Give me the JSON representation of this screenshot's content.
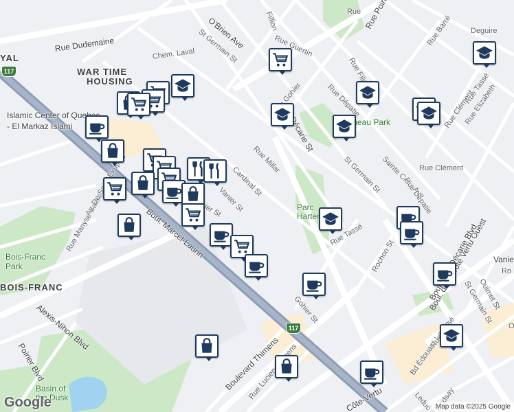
{
  "map": {
    "attribution": "Map data ©2025 Google",
    "logo": "Google",
    "highway_shields": [
      "117",
      "117"
    ],
    "labels": [
      {
        "text": "Rue Dudemaine",
        "style": "dark"
      },
      {
        "text": "WAR TIME",
        "style": "big"
      },
      {
        "text": "HOUSING",
        "style": "big"
      },
      {
        "text": "Chem. Laval",
        "style": ""
      },
      {
        "text": "O'Brien Ave",
        "style": "dark"
      },
      {
        "text": "St Germain St",
        "style": ""
      },
      {
        "text": "Rue Guertin",
        "style": ""
      },
      {
        "text": "Rue Poirier",
        "style": "dark"
      },
      {
        "text": "Rue Barré",
        "style": ""
      },
      {
        "text": "Deguire",
        "style": ""
      },
      {
        "text": "Rue Tassé",
        "style": ""
      },
      {
        "text": "Rue Filion",
        "style": ""
      },
      {
        "text": "Rue Dépatie",
        "style": ""
      },
      {
        "text": "Rue Clément",
        "style": ""
      },
      {
        "text": "Rue Elizabeth",
        "style": ""
      },
      {
        "text": "Chameau Park",
        "style": "park"
      },
      {
        "text": "Décarie St",
        "style": "dark"
      },
      {
        "text": "Rue Millar",
        "style": ""
      },
      {
        "text": "St Germain St",
        "style": ""
      },
      {
        "text": "Sainte Croix Ave",
        "style": ""
      },
      {
        "text": "Rue Dépatie",
        "style": ""
      },
      {
        "text": "Rue Clément",
        "style": ""
      },
      {
        "text": "Parc",
        "style": "park"
      },
      {
        "text": "Hartens",
        "style": "park"
      },
      {
        "text": "Rue Tassé",
        "style": ""
      },
      {
        "text": "Rochon St",
        "style": ""
      },
      {
        "text": "Boul. de la Côte Vertu Ouest",
        "style": "dark"
      },
      {
        "text": "Vanier",
        "style": "dark"
      },
      {
        "text": "St Germain St",
        "style": ""
      },
      {
        "text": "Ouimet St",
        "style": ""
      },
      {
        "text": "Boulevard Décarie Blvd",
        "style": "dark"
      },
      {
        "text": "Bd Édouard-Laurin",
        "style": ""
      },
      {
        "text": "Rue Tassé",
        "style": ""
      },
      {
        "text": "Ouimet",
        "style": ""
      },
      {
        "text": "Ro",
        "style": ""
      },
      {
        "text": "Islamic Center of Quebec",
        "style": "dark"
      },
      {
        "text": "- El Markaz Islami",
        "style": "dark"
      },
      {
        "text": "YAL",
        "style": "big"
      },
      {
        "text": "Cardinal St",
        "style": ""
      },
      {
        "text": "Vanier St",
        "style": ""
      },
      {
        "text": "Gohier St",
        "style": ""
      },
      {
        "text": "Boul. Marcel-Laurin",
        "style": "dark"
      },
      {
        "text": "Rue Manyse-Bastié",
        "style": ""
      },
      {
        "text": "Av. De Saint-Exupéry",
        "style": ""
      },
      {
        "text": "Bois-Franc",
        "style": "park"
      },
      {
        "text": "Park",
        "style": "park"
      },
      {
        "text": "BOIS-FRANC",
        "style": "big"
      },
      {
        "text": "Alexis-Nihon Blvd",
        "style": "dark"
      },
      {
        "text": "Poirier Blvd",
        "style": "dark"
      },
      {
        "text": "Basin of",
        "style": "park"
      },
      {
        "text": "the Dusk",
        "style": "park"
      },
      {
        "text": "Boulevard Thimens",
        "style": "dark"
      },
      {
        "text": "Rue Lucien-Thimens",
        "style": ""
      },
      {
        "text": "Côte-Vertu",
        "style": "dark"
      },
      {
        "text": "Gohier St",
        "style": ""
      },
      {
        "text": "Leduc St",
        "style": ""
      },
      {
        "text": "Lindsay",
        "style": ""
      },
      {
        "text": "Rue Gohier",
        "style": ""
      },
      {
        "text": "Fillion",
        "style": ""
      },
      {
        "text": "Rue",
        "style": ""
      }
    ],
    "markers": [
      {
        "icon": "cart"
      },
      {
        "icon": "school"
      },
      {
        "icon": "school"
      },
      {
        "icon": "school"
      },
      {
        "icon": "school"
      },
      {
        "icon": "school"
      },
      {
        "icon": "school"
      },
      {
        "icon": "cart"
      },
      {
        "icon": "cart"
      },
      {
        "icon": "school"
      },
      {
        "icon": "bag"
      },
      {
        "icon": "cart"
      },
      {
        "icon": "coffee"
      },
      {
        "icon": "bag"
      },
      {
        "icon": "cart"
      },
      {
        "icon": "cart"
      },
      {
        "icon": "cart"
      },
      {
        "icon": "restaurant"
      },
      {
        "icon": "restaurant"
      },
      {
        "icon": "cart"
      },
      {
        "icon": "bag"
      },
      {
        "icon": "coffee"
      },
      {
        "icon": "bag"
      },
      {
        "icon": "cart"
      },
      {
        "icon": "bag"
      },
      {
        "icon": "coffee"
      },
      {
        "icon": "cart"
      },
      {
        "icon": "coffee"
      },
      {
        "icon": "coffee"
      },
      {
        "icon": "school"
      },
      {
        "icon": "coffee"
      },
      {
        "icon": "coffee"
      },
      {
        "icon": "coffee"
      },
      {
        "icon": "school"
      },
      {
        "icon": "bag"
      },
      {
        "icon": "bag"
      },
      {
        "icon": "coffee"
      }
    ]
  }
}
